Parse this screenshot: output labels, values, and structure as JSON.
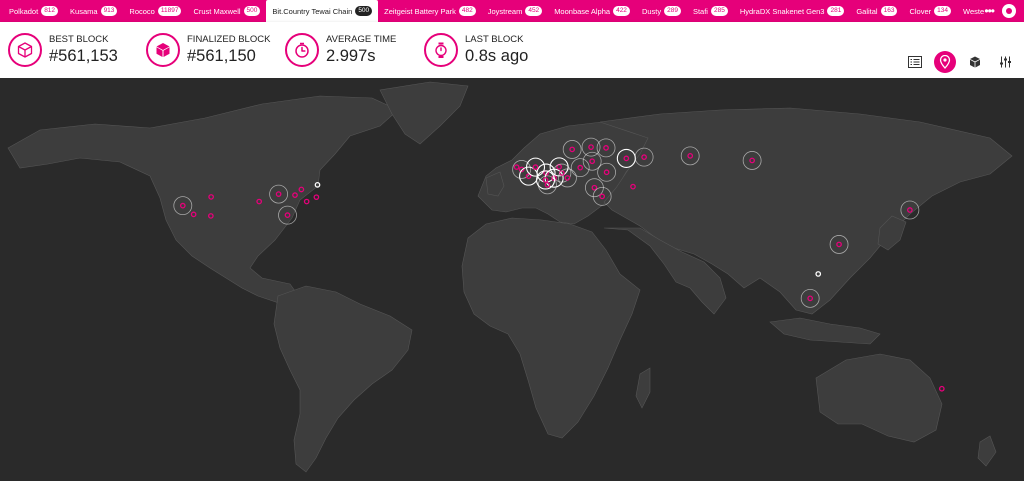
{
  "chains": [
    {
      "name": "Polkadot",
      "count": "812"
    },
    {
      "name": "Kusama",
      "count": "913"
    },
    {
      "name": "Rococo",
      "count": "11897"
    },
    {
      "name": "Crust Maxwell",
      "count": "500"
    },
    {
      "name": "Bit.Country Tewai Chain",
      "count": "500",
      "active": true
    },
    {
      "name": "Zeitgeist Battery Park",
      "count": "482"
    },
    {
      "name": "Joystream",
      "count": "452"
    },
    {
      "name": "Moonbase Alpha",
      "count": "422"
    },
    {
      "name": "Dusty",
      "count": "289"
    },
    {
      "name": "Stafi",
      "count": "285"
    },
    {
      "name": "HydraDX Snakenet Gen3",
      "count": "281"
    },
    {
      "name": "Galital",
      "count": "163"
    },
    {
      "name": "Clover",
      "count": "134"
    },
    {
      "name": "Westend",
      "count": "125"
    }
  ],
  "top_actions": {
    "more": "•••"
  },
  "stats": {
    "best_block": {
      "label": "BEST BLOCK",
      "value": "#561,153",
      "icon": "cube-outline-icon"
    },
    "finalized_block": {
      "label": "FINALIZED BLOCK",
      "value": "#561,150",
      "icon": "cube-solid-icon"
    },
    "average_time": {
      "label": "AVERAGE TIME",
      "value": "2.997s",
      "icon": "timer-icon"
    },
    "last_block": {
      "label": "LAST BLOCK",
      "value": "0.8s ago",
      "icon": "stopwatch-icon"
    }
  },
  "views": [
    {
      "name": "list-view",
      "active": false
    },
    {
      "name": "map-view",
      "active": true
    },
    {
      "name": "consensus-view",
      "active": false
    },
    {
      "name": "settings-view",
      "active": false
    }
  ],
  "colors": {
    "accent": "#e6007a",
    "map_bg": "#2a2a2a",
    "land": "#3d3d3d",
    "header_bg": "#ffffff"
  },
  "map": {
    "nodes": [
      {
        "lat": 37.4,
        "lon": -122.1,
        "ring": true
      },
      {
        "lat": 34.0,
        "lon": -118.2,
        "ring": false
      },
      {
        "lat": 40.8,
        "lon": -111.9,
        "ring": false
      },
      {
        "lat": 33.4,
        "lon": -112.0,
        "ring": false
      },
      {
        "lat": 41.9,
        "lon": -87.6,
        "ring": true
      },
      {
        "lat": 39.0,
        "lon": -94.6,
        "ring": false
      },
      {
        "lat": 40.7,
        "lon": -74.0,
        "ring": false
      },
      {
        "lat": 39.0,
        "lon": -77.5,
        "ring": false
      },
      {
        "lat": 43.7,
        "lon": -79.4,
        "ring": false
      },
      {
        "lat": 33.7,
        "lon": -84.4,
        "ring": true
      },
      {
        "lat": 45.5,
        "lon": -73.6,
        "ring": false,
        "white": true
      },
      {
        "lat": 41.5,
        "lon": -81.7,
        "ring": false
      },
      {
        "lat": 52.4,
        "lon": -1.9,
        "ring": false
      },
      {
        "lat": 51.5,
        "lon": -0.1,
        "ring": true
      },
      {
        "lat": 48.9,
        "lon": 2.4,
        "ring": true,
        "bright": true
      },
      {
        "lat": 50.1,
        "lon": 8.7,
        "ring": true,
        "bright": true
      },
      {
        "lat": 52.4,
        "lon": 4.9,
        "ring": true,
        "bright": true
      },
      {
        "lat": 52.5,
        "lon": 13.4,
        "ring": true,
        "bright": true
      },
      {
        "lat": 48.1,
        "lon": 11.6,
        "ring": true,
        "bright": true
      },
      {
        "lat": 47.4,
        "lon": 8.5,
        "ring": true,
        "bright": true
      },
      {
        "lat": 50.1,
        "lon": 14.4,
        "ring": true
      },
      {
        "lat": 52.2,
        "lon": 21.0,
        "ring": true
      },
      {
        "lat": 48.2,
        "lon": 16.4,
        "ring": true
      },
      {
        "lat": 45.5,
        "lon": 9.2,
        "ring": true
      },
      {
        "lat": 44.4,
        "lon": 26.1,
        "ring": true
      },
      {
        "lat": 41.0,
        "lon": 28.9,
        "ring": true
      },
      {
        "lat": 59.3,
        "lon": 18.1,
        "ring": true
      },
      {
        "lat": 60.2,
        "lon": 24.9,
        "ring": true
      },
      {
        "lat": 59.9,
        "lon": 30.3,
        "ring": true
      },
      {
        "lat": 55.8,
        "lon": 37.6,
        "ring": true,
        "bright": true
      },
      {
        "lat": 54.7,
        "lon": 25.3,
        "ring": true
      },
      {
        "lat": 50.4,
        "lon": 30.5,
        "ring": true
      },
      {
        "lat": 56.3,
        "lon": 44.0,
        "ring": true
      },
      {
        "lat": 55.0,
        "lon": 82.9,
        "ring": true
      },
      {
        "lat": 56.8,
        "lon": 60.6,
        "ring": true
      },
      {
        "lat": 44.8,
        "lon": 40.0,
        "ring": false
      },
      {
        "lat": 35.7,
        "lon": 139.7,
        "ring": true
      },
      {
        "lat": 22.3,
        "lon": 114.2,
        "ring": true
      },
      {
        "lat": 1.3,
        "lon": 103.8,
        "ring": true
      },
      {
        "lat": 10.8,
        "lon": 106.7,
        "ring": false,
        "white": true
      },
      {
        "lat": -33.9,
        "lon": 151.2,
        "ring": false
      }
    ]
  }
}
